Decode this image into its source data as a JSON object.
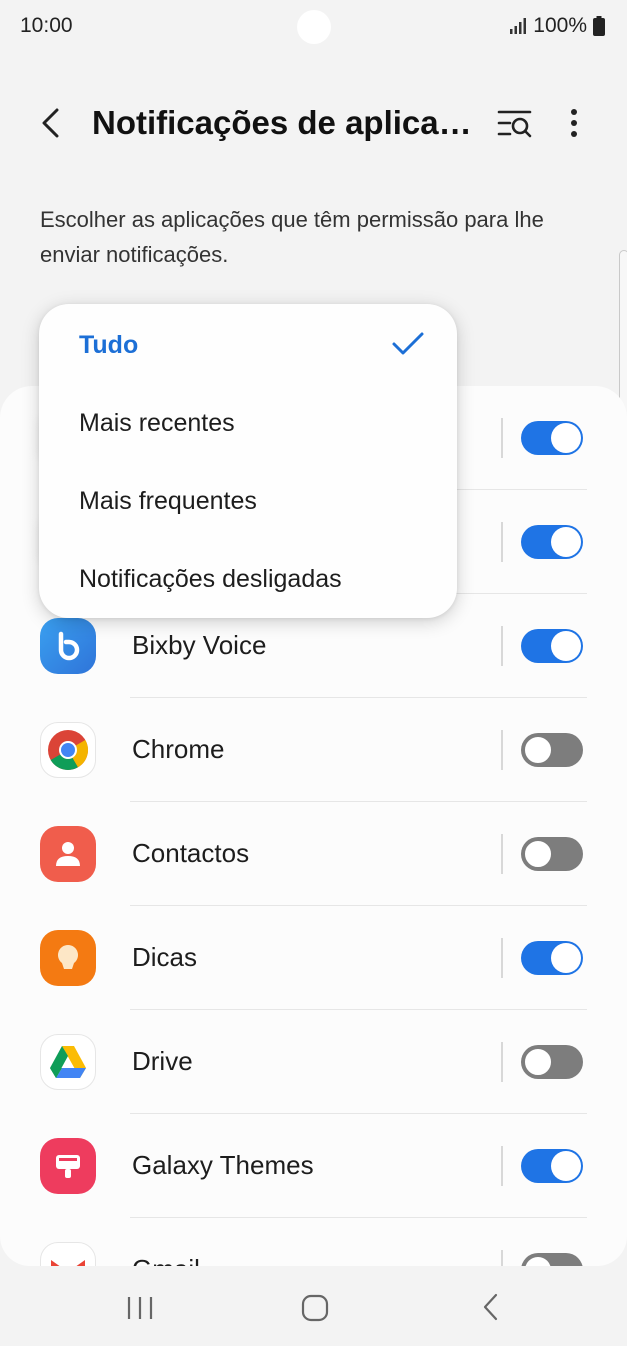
{
  "status_bar": {
    "time": "10:00",
    "battery": "100%"
  },
  "header": {
    "title": "Notificações de aplicações",
    "back_icon": "back-chevron-icon",
    "search_icon": "filter-search-icon",
    "more_icon": "more-vertical-icon"
  },
  "description": "Escolher as aplicações que têm permissão para lhe enviar notificações.",
  "dropdown": {
    "items": [
      {
        "label": "Tudo",
        "selected": true
      },
      {
        "label": "Mais recentes",
        "selected": false
      },
      {
        "label": "Mais frequentes",
        "selected": false
      },
      {
        "label": "Notificações desligadas",
        "selected": false
      }
    ],
    "accent_color": "#1c6fd6"
  },
  "apps": [
    {
      "name": "",
      "enabled": true
    },
    {
      "name": "",
      "enabled": true
    },
    {
      "name": "Bixby Voice",
      "enabled": true
    },
    {
      "name": "Chrome",
      "enabled": false
    },
    {
      "name": "Contactos",
      "enabled": false
    },
    {
      "name": "Dicas",
      "enabled": true
    },
    {
      "name": "Drive",
      "enabled": false
    },
    {
      "name": "Galaxy Themes",
      "enabled": true
    },
    {
      "name": "Gmail",
      "enabled": false
    }
  ],
  "colors": {
    "toggle_on": "#1f74e5",
    "toggle_off": "#7d7d7d"
  }
}
